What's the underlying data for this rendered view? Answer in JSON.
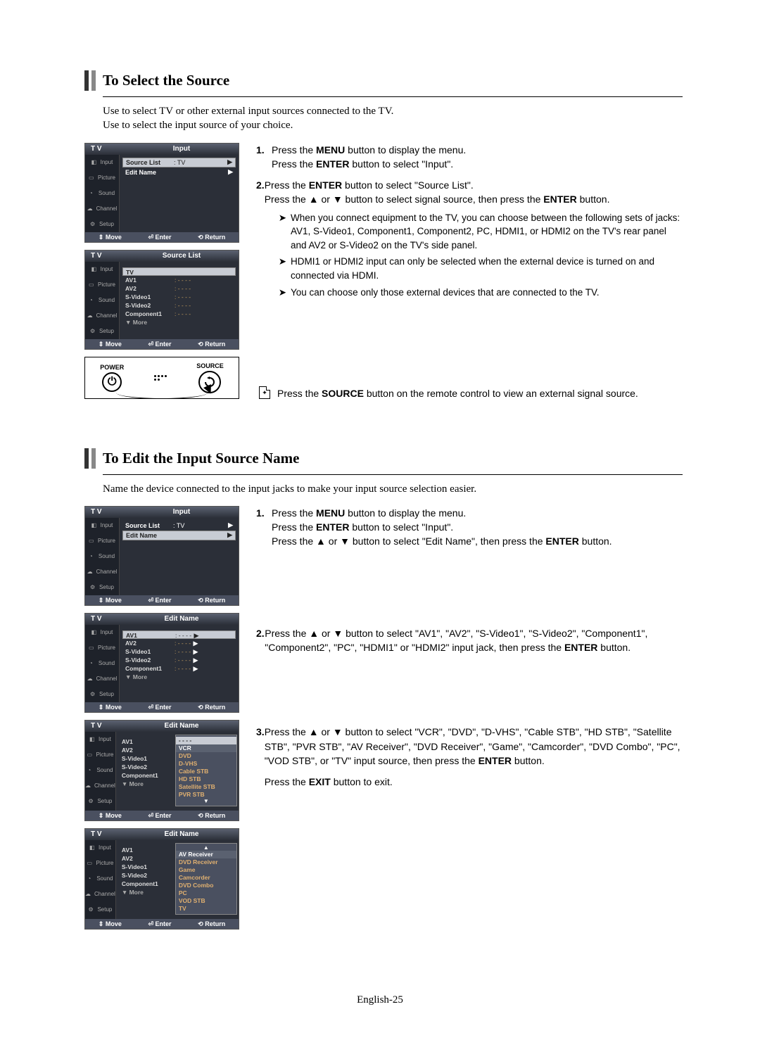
{
  "section1": {
    "title": "To Select the Source",
    "intro_line1": "Use to select TV or other external input sources connected to the TV.",
    "intro_line2": "Use to select the input source of your choice.",
    "steps": [
      {
        "text1": "Press the ",
        "bold1": "MENU",
        "text2": " button to display the menu.",
        "line2a": "Press the ",
        "line2b": "ENTER",
        "line2c": " button to select \"Input\"."
      },
      {
        "text1": "Press the ",
        "bold1": "ENTER",
        "text2": " button to select \"Source List\".",
        "line2a": "Press the ",
        "line2b": "▲",
        "line2c": " or ",
        "line2d": "▼",
        "line2e": " button to select signal source, then press the ",
        "line2f": "ENTER",
        "line2g": " button."
      }
    ],
    "subnotes": [
      "When you connect equipment to the TV, you can choose between the following sets of jacks: AV1, S-Video1, Component1, Component2, PC, HDMI1, or HDMI2 on the TV's rear panel and AV2 or S-Video2 on the TV's side panel.",
      "HDMI1 or HDMI2 input can only be selected when the external device is turned on and connected via HDMI.",
      "You can choose only those external devices that are connected to the TV."
    ],
    "remote_note_pre": "Press the ",
    "remote_note_bold": "SOURCE",
    "remote_note_post": " button on the remote control to view an external signal source."
  },
  "section2": {
    "title": "To Edit the Input Source Name",
    "intro": "Name the device connected to the input jacks to make your input source selection easier.",
    "steps": [
      {
        "l1a": "Press the ",
        "l1b": "MENU",
        "l1c": " button to display the menu.",
        "l2a": "Press the ",
        "l2b": "ENTER",
        "l2c": " button to select \"Input\".",
        "l3a": "Press the ",
        "l3b": "▲",
        "l3c": " or ",
        "l3d": "▼",
        "l3e": " button to select \"Edit Name\", then press the ",
        "l3f": "ENTER",
        "l3g": " button."
      },
      {
        "l1a": "Press the ",
        "l1b": "▲",
        "l1c": " or ",
        "l1d": "▼",
        "l1e": " button to select \"AV1\", \"AV2\", \"S-Video1\", \"S-Video2\", \"Component1\", \"Component2\", \"PC\", \"HDMI1\" or \"HDMI2\" input jack, then press the ",
        "l1f": "ENTER",
        "l1g": " button."
      },
      {
        "l1a": "Press the ",
        "l1b": "▲",
        "l1c": " or ",
        "l1d": "▼",
        "l1e": " button to select \"VCR\", \"DVD\", \"D-VHS\", \"Cable STB\", \"HD STB\", \"Satellite STB\", \"PVR STB\", \"AV Receiver\", \"DVD Receiver\", \"Game\", \"Camcorder\", \"DVD Combo\", \"PC\", \"VOD STB\", or \"TV\" input source, then press the ",
        "l1f": "ENTER",
        "l1g": " button.",
        "l2a": "Press the ",
        "l2b": "EXIT",
        "l2c": " button to exit."
      }
    ]
  },
  "osd": {
    "tv_label": "T V",
    "sidebar": [
      "Input",
      "Picture",
      "Sound",
      "Channel",
      "Setup"
    ],
    "footer_move": "Move",
    "footer_enter": "Enter",
    "footer_return": "Return",
    "updown": "⇕",
    "enter_icon": "⏎",
    "return_icon": "⟲",
    "menus": {
      "input_title": "Input",
      "source_list_title": "Source List",
      "edit_name_title": "Edit Name",
      "source_list_row": "Source List",
      "source_list_val": ": TV",
      "edit_name_row": "Edit Name",
      "sources": [
        {
          "name": "TV",
          "val": ""
        },
        {
          "name": "AV1",
          "val": ": - - - -"
        },
        {
          "name": "AV2",
          "val": ": - - - -"
        },
        {
          "name": "S-Video1",
          "val": ": - - - -"
        },
        {
          "name": "S-Video2",
          "val": ": - - - -"
        },
        {
          "name": "Component1",
          "val": ": - - - -"
        }
      ],
      "more": "▼ More",
      "edit_items": [
        {
          "name": "AV1",
          "val": ": - - - -"
        },
        {
          "name": "AV2",
          "val": ": - - - -"
        },
        {
          "name": "S-Video1",
          "val": ": - - - -"
        },
        {
          "name": "S-Video2",
          "val": ": - - - -"
        },
        {
          "name": "Component1",
          "val": ": - - - -"
        }
      ],
      "popup1_header": "- - - -",
      "popup1": [
        "VCR",
        "DVD",
        "D-VHS",
        "Cable STB",
        "HD STB",
        "Satellite STB",
        "PVR STB"
      ],
      "popup2": [
        "AV Receiver",
        "DVD Receiver",
        "Game",
        "Camcorder",
        "DVD Combo",
        "PC",
        "VOD STB",
        "TV"
      ]
    },
    "remote": {
      "power": "POWER",
      "source": "SOURCE",
      "power_sym": "⏻"
    }
  },
  "footer": "English-25"
}
